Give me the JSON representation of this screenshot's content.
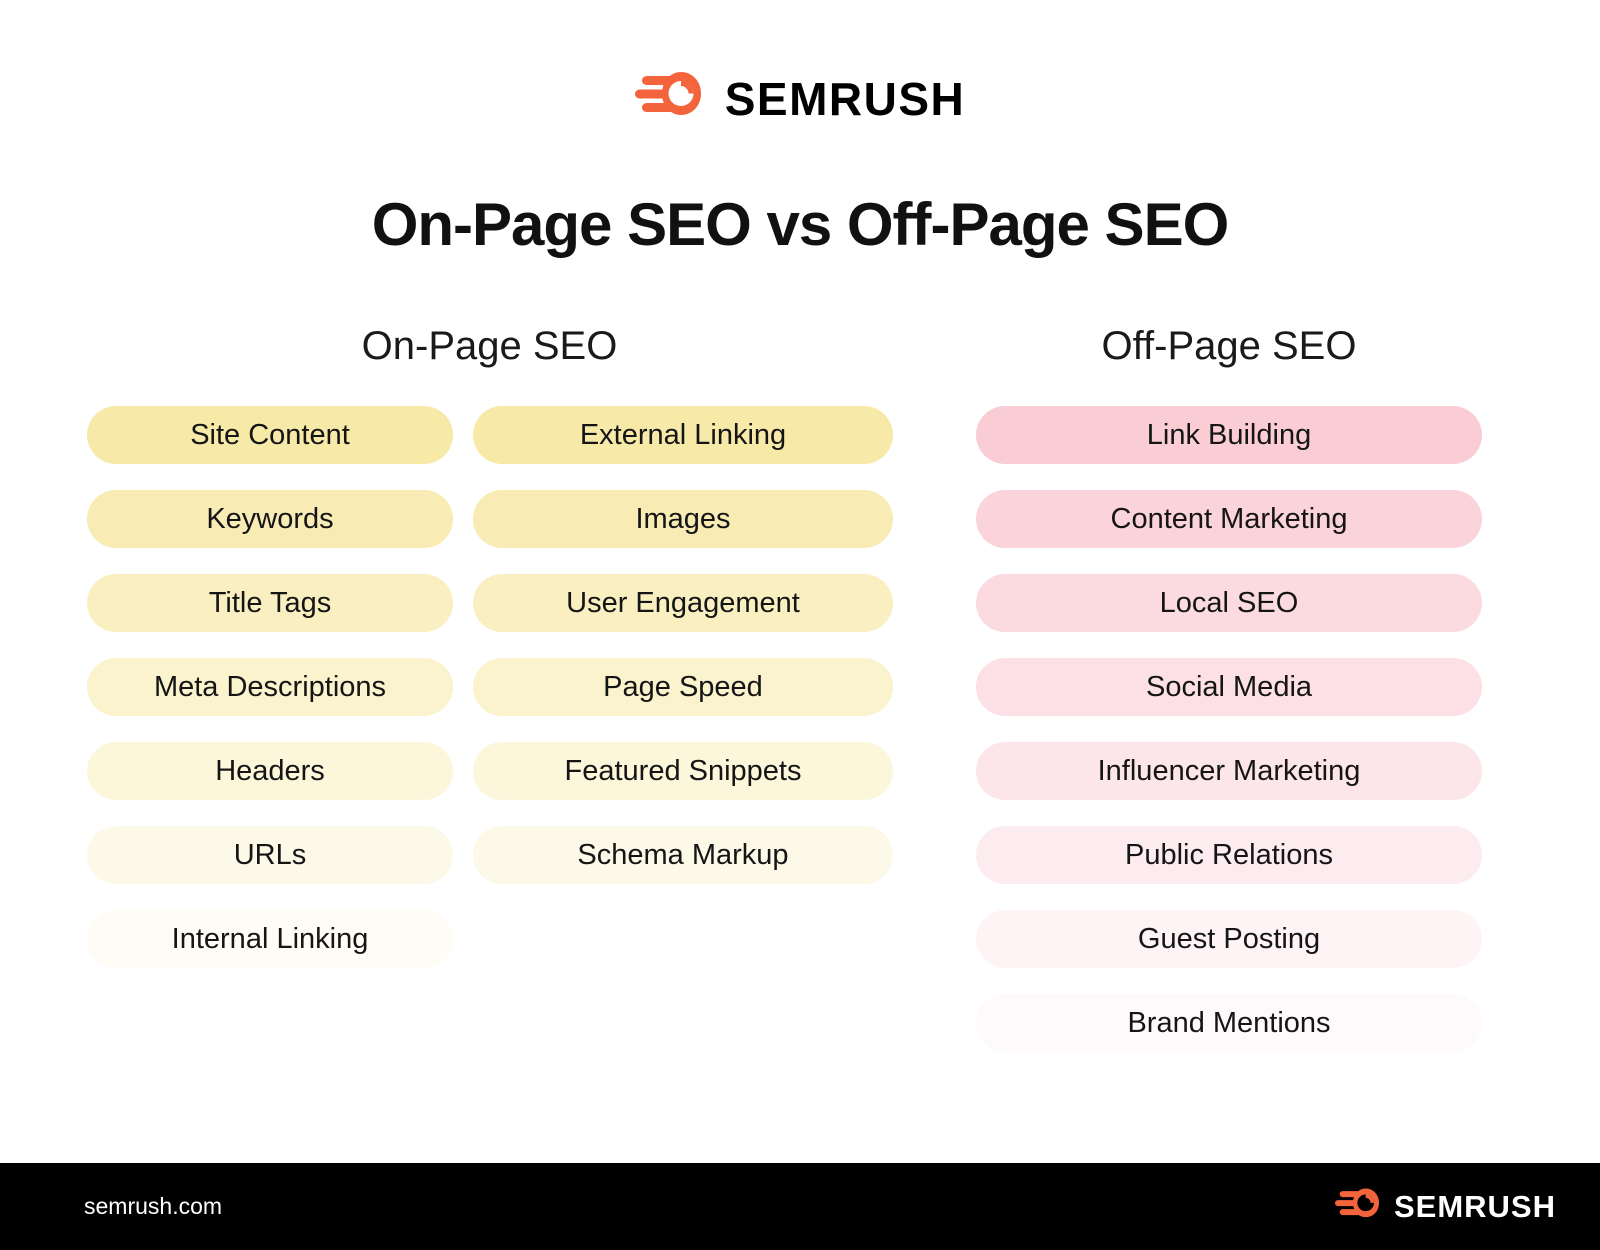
{
  "brand": {
    "logo_icon": "semrush-comet-icon",
    "wordmark": "SEMRUSH",
    "logo_color": "#F4643C"
  },
  "title": "On-Page SEO vs Off-Page SEO",
  "sections": {
    "on_page": {
      "heading": "On-Page SEO",
      "accent_color": "#F7E9A7",
      "column_1": [
        "Site Content",
        "Keywords",
        "Title Tags",
        "Meta Descriptions",
        "Headers",
        "URLs",
        "Internal Linking"
      ],
      "column_2": [
        "External Linking",
        "Images",
        "User Engagement",
        "Page Speed",
        "Featured Snippets",
        "Schema Markup"
      ]
    },
    "off_page": {
      "heading": "Off-Page SEO",
      "accent_color": "#FACDD5",
      "items": [
        "Link Building",
        "Content Marketing",
        "Local SEO",
        "Social Media",
        "Influencer Marketing",
        "Public Relations",
        "Guest Posting",
        "Brand Mentions"
      ]
    }
  },
  "footer": {
    "url": "semrush.com",
    "wordmark": "SEMRUSH",
    "background": "#000000",
    "text_color": "#FFFFFF"
  }
}
